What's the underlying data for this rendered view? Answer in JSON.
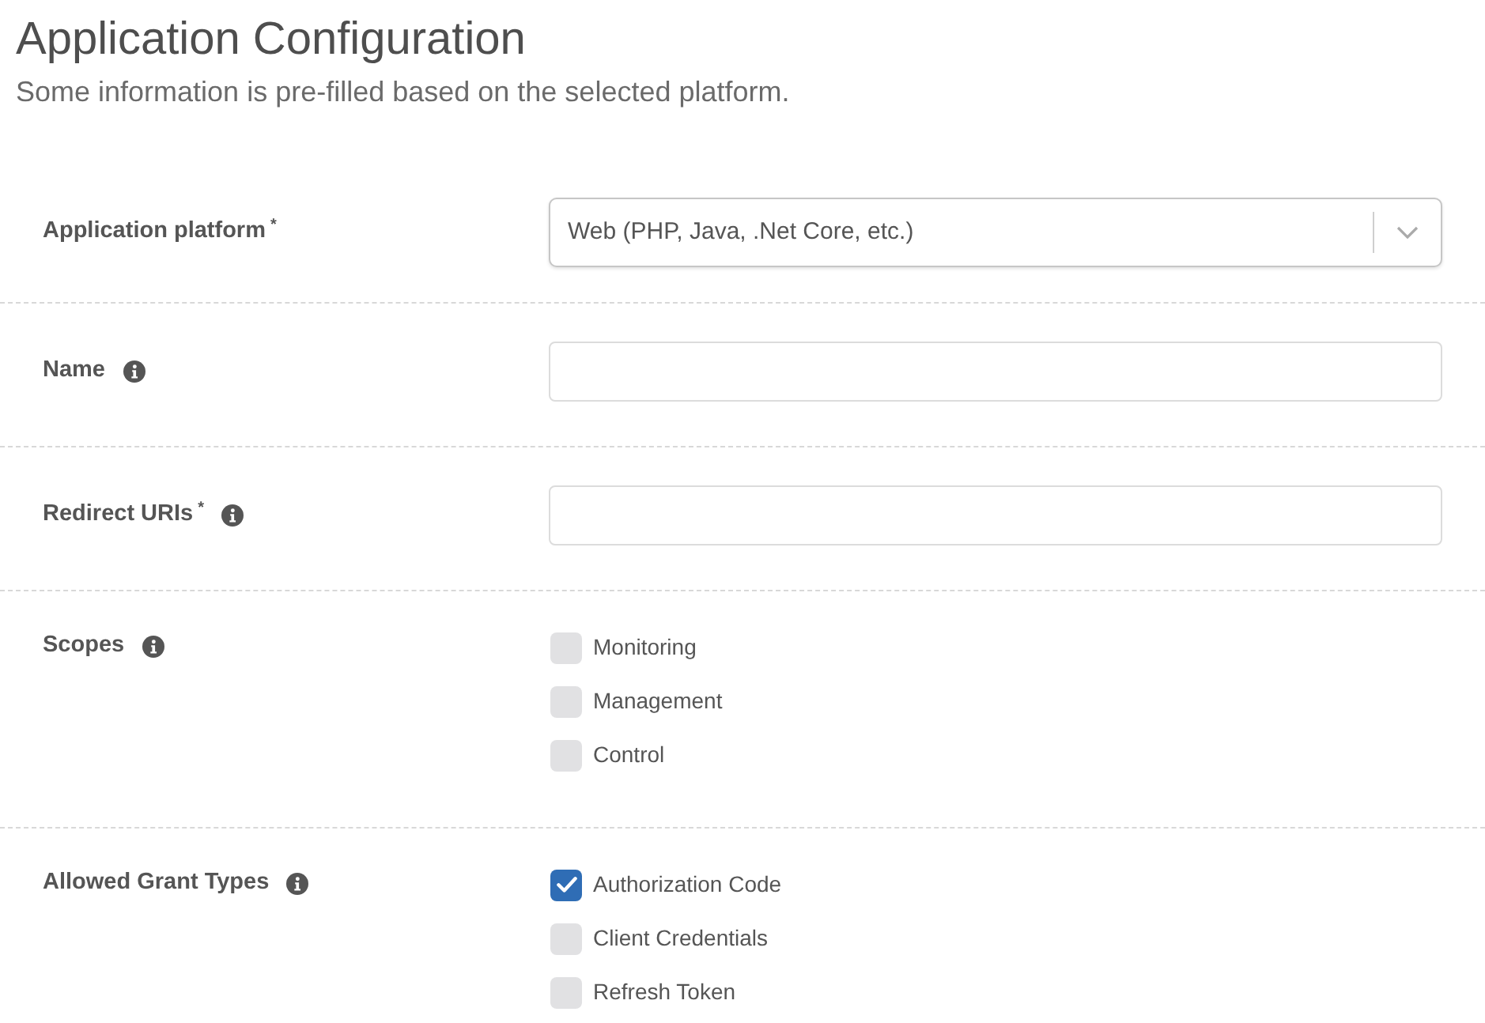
{
  "header": {
    "title": "Application Configuration",
    "subtitle": "Some information is pre-filled based on the selected platform."
  },
  "fields": [
    {
      "kind": "select",
      "label": "Application platform$^{*}$",
      "info": false,
      "value": "Web (PHP, Java, .Net Core, etc.)"
    },
    {
      "kind": "text",
      "label": "Name",
      "info": true
    },
    {
      "kind": "text",
      "label": "Redirect URIs$^{*}$",
      "info": true
    },
    {
      "kind": "checkboxes",
      "label": "Scopes",
      "info": true,
      "options": [
        {
          "label": "Monitoring",
          "checked": false
        },
        {
          "label": "Management",
          "checked": false
        },
        {
          "label": "Control",
          "checked": false
        }
      ]
    },
    {
      "kind": "checkboxes",
      "label": "Allowed Grant Types",
      "info": true,
      "options": [
        {
          "label": "Authorization Code",
          "checked": true
        },
        {
          "label": "Client Credentials",
          "checked": false
        },
        {
          "label": "Refresh Token",
          "checked": false
        }
      ]
    }
  ]
}
